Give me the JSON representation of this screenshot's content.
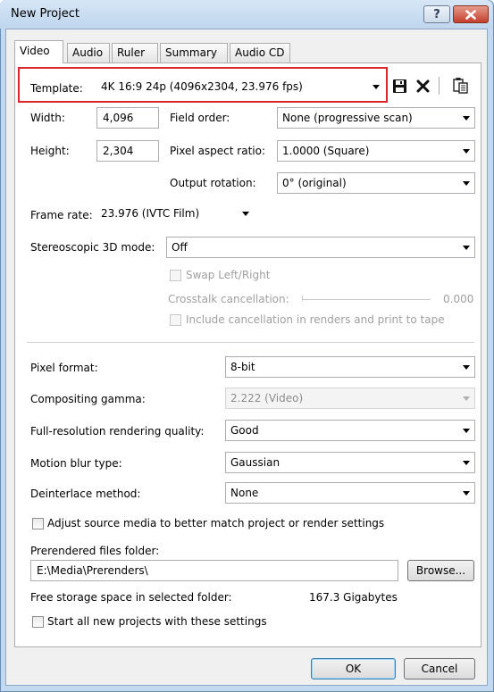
{
  "window": {
    "title": "New Project",
    "help_label": "?",
    "close_label": "x"
  },
  "tabs": [
    {
      "label": "Video",
      "active": true
    },
    {
      "label": "Audio"
    },
    {
      "label": "Ruler"
    },
    {
      "label": "Summary"
    },
    {
      "label": "Audio CD"
    }
  ],
  "template": {
    "label": "Template:",
    "value": "4K 16:9 24p (4096x2304, 23.976 fps)",
    "icons": [
      "save-icon",
      "delete-icon",
      "clipboard-icon"
    ]
  },
  "video": {
    "width_label": "Width:",
    "width_value": "4,096",
    "height_label": "Height:",
    "height_value": "2,304",
    "field_order_label": "Field order:",
    "field_order_value": "None (progressive scan)",
    "par_label": "Pixel aspect ratio:",
    "par_value": "1.0000 (Square)",
    "rotation_label": "Output rotation:",
    "rotation_value": "0° (original)",
    "frame_rate_label": "Frame rate:",
    "frame_rate_value": "23.976 (IVTC Film)",
    "stereo_label": "Stereoscopic 3D mode:",
    "stereo_value": "Off",
    "swap_label": "Swap Left/Right",
    "crosstalk_label": "Crosstalk cancellation:",
    "crosstalk_value": "0.000",
    "include_cancel_label": "Include cancellation in renders and print to tape"
  },
  "render": {
    "pixel_format_label": "Pixel format:",
    "pixel_format_value": "8-bit",
    "gamma_label": "Compositing gamma:",
    "gamma_value": "2.222 (Video)",
    "quality_label": "Full-resolution rendering quality:",
    "quality_value": "Good",
    "motion_blur_label": "Motion blur type:",
    "motion_blur_value": "Gaussian",
    "deinterlace_label": "Deinterlace method:",
    "deinterlace_value": "None",
    "adjust_source_label": "Adjust source media to better match project or render settings",
    "prerender_label": "Prerendered files folder:",
    "prerender_value": "E:\\Media\\Prerenders\\",
    "browse_label": "Browse...",
    "storage_label": "Free storage space in selected folder:",
    "storage_value": "167.3 Gigabytes",
    "start_all_label": "Start all new projects with these settings"
  },
  "footer": {
    "ok_label": "OK",
    "cancel_label": "Cancel"
  },
  "colors": {
    "highlight": "#d9262a",
    "titlebar": "#c2d9f0",
    "close_button": "#c3402b"
  }
}
